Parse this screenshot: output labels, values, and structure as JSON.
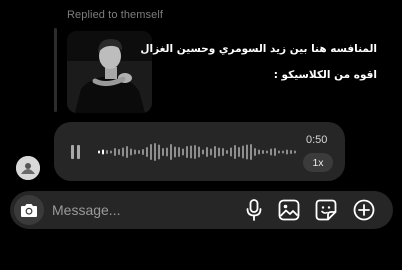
{
  "reply": {
    "label": "Replied to themself"
  },
  "message": {
    "caption_line1": "المنافسه هنا بين زيد السومري وحسين الغزال",
    "caption_line2": "اقوه من الكلاسيكو :"
  },
  "voice_note": {
    "duration": "0:50",
    "speed": "1x",
    "icon": "pause-icon",
    "progress": 0.04,
    "waveform": [
      3,
      5,
      4,
      3,
      8,
      6,
      9,
      12,
      7,
      5,
      4,
      6,
      10,
      16,
      18,
      15,
      8,
      9,
      16,
      11,
      10,
      7,
      12,
      13,
      14,
      11,
      5,
      10,
      7,
      12,
      9,
      8,
      4,
      9,
      14,
      10,
      13,
      15,
      16,
      8,
      5,
      4,
      3,
      7,
      8,
      3,
      3,
      5,
      4,
      3
    ]
  },
  "composer": {
    "placeholder": "Message...",
    "icons": [
      "camera-icon",
      "microphone-icon",
      "gallery-icon",
      "sticker-icon",
      "plus-icon"
    ]
  },
  "colors": {
    "background": "#000000",
    "bubble": "#262626",
    "accent": "#ffffff"
  }
}
